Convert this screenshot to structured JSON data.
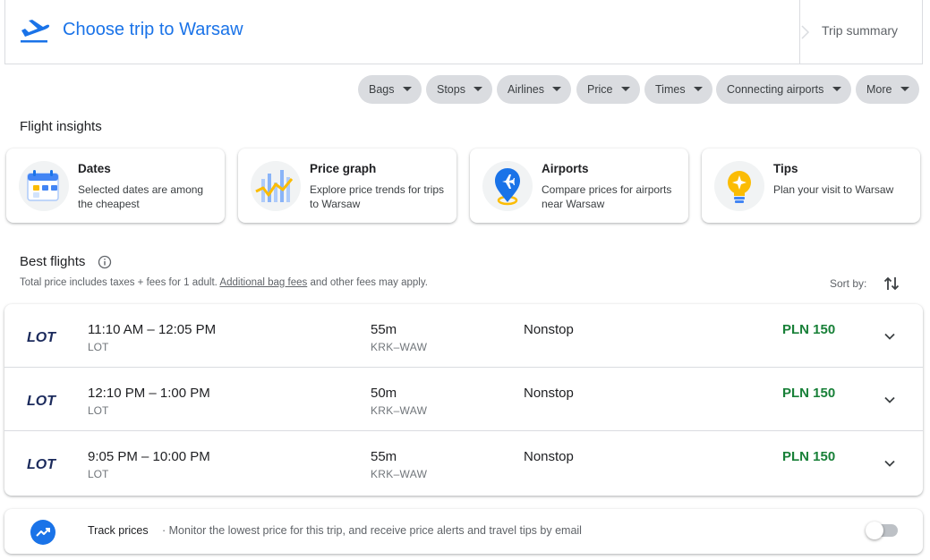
{
  "header": {
    "title": "Choose trip to Warsaw",
    "trip_summary": "Trip summary"
  },
  "filters": [
    {
      "label": "Bags"
    },
    {
      "label": "Stops"
    },
    {
      "label": "Airlines"
    },
    {
      "label": "Price"
    },
    {
      "label": "Times"
    },
    {
      "label": "Connecting airports"
    },
    {
      "label": "More"
    }
  ],
  "insights": {
    "title": "Flight insights",
    "cards": [
      {
        "title": "Dates",
        "desc": "Selected dates are among the cheapest",
        "icon": "calendar-icon"
      },
      {
        "title": "Price graph",
        "desc": "Explore price trends for trips to Warsaw",
        "icon": "price-graph-icon"
      },
      {
        "title": "Airports",
        "desc": "Compare prices for airports near Warsaw",
        "icon": "airport-pin-icon"
      },
      {
        "title": "Tips",
        "desc": "Plan your visit to Warsaw",
        "icon": "lightbulb-icon"
      }
    ]
  },
  "best_flights": {
    "title": "Best flights",
    "disclaimer_pre": "Total price includes taxes + fees for 1 adult.",
    "disclaimer_link": "Additional bag fees",
    "disclaimer_post": "and other fees may apply.",
    "sort_label": "Sort by:",
    "flights": [
      {
        "times": "11:10 AM – 12:05 PM",
        "airline": "LOT",
        "duration": "55m",
        "route": "KRK–WAW",
        "stops": "Nonstop",
        "price": "PLN 150"
      },
      {
        "times": "12:10 PM – 1:00 PM",
        "airline": "LOT",
        "duration": "50m",
        "route": "KRK–WAW",
        "stops": "Nonstop",
        "price": "PLN 150"
      },
      {
        "times": "9:05 PM – 10:00 PM",
        "airline": "LOT",
        "duration": "55m",
        "route": "KRK–WAW",
        "stops": "Nonstop",
        "price": "PLN 150"
      }
    ]
  },
  "track_prices": {
    "label": "Track prices",
    "desc": "· Monitor the lowest price for this trip, and receive price alerts and travel tips by email",
    "enabled": false
  },
  "colors": {
    "accent": "#1a73e8",
    "price_green": "#188038",
    "lot_navy": "#1b2a5c"
  }
}
